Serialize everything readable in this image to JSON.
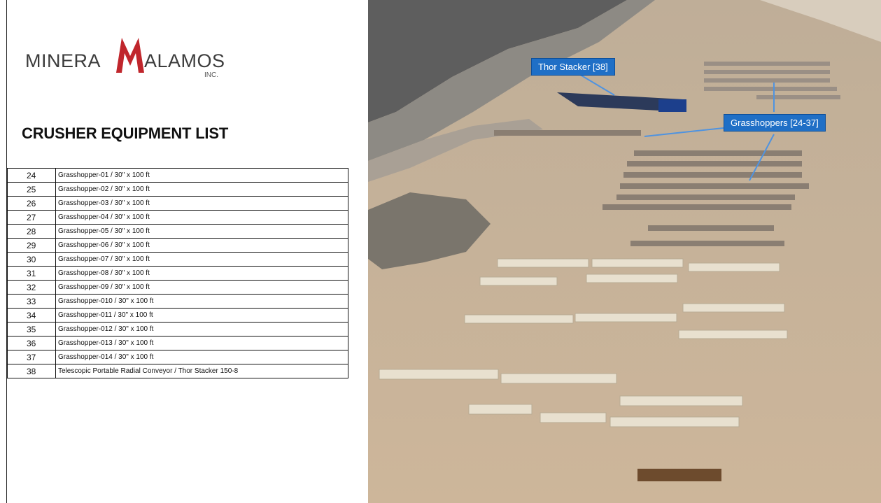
{
  "logo": {
    "left_text": "MINERA",
    "right_text": "ALAMOS",
    "suffix": "INC.",
    "brand_color": "#c0262c"
  },
  "heading": "CRUSHER EQUIPMENT LIST",
  "equipment": [
    {
      "num": "24",
      "desc": "Grasshopper-01 / 30\" x 100 ft"
    },
    {
      "num": "25",
      "desc": "Grasshopper-02 / 30\" x 100 ft"
    },
    {
      "num": "26",
      "desc": "Grasshopper-03 / 30\" x 100 ft"
    },
    {
      "num": "27",
      "desc": "Grasshopper-04 / 30\" x 100 ft"
    },
    {
      "num": "28",
      "desc": "Grasshopper-05 / 30\" x 100 ft"
    },
    {
      "num": "29",
      "desc": "Grasshopper-06 / 30\" x 100 ft"
    },
    {
      "num": "30",
      "desc": "Grasshopper-07 / 30\" x 100 ft"
    },
    {
      "num": "31",
      "desc": "Grasshopper-08 / 30\" x 100 ft"
    },
    {
      "num": "32",
      "desc": "Grasshopper-09 / 30\" x 100 ft"
    },
    {
      "num": "33",
      "desc": "Grasshopper-010 / 30\" x 100 ft"
    },
    {
      "num": "34",
      "desc": "Grasshopper-011 / 30\" x 100 ft"
    },
    {
      "num": "35",
      "desc": "Grasshopper-012 / 30\" x 100 ft"
    },
    {
      "num": "36",
      "desc": "Grasshopper-013 / 30\" x 100 ft"
    },
    {
      "num": "37",
      "desc": "Grasshopper-014 / 30\" x 100 ft"
    },
    {
      "num": "38",
      "desc": "Telescopic Portable Radial Conveyor / Thor Stacker 150-8"
    }
  ],
  "photo": {
    "callouts": {
      "thor": "Thor Stacker [38]",
      "grasshoppers": "Grasshoppers [24-37]"
    },
    "callout_color": "#1f6fc6"
  }
}
